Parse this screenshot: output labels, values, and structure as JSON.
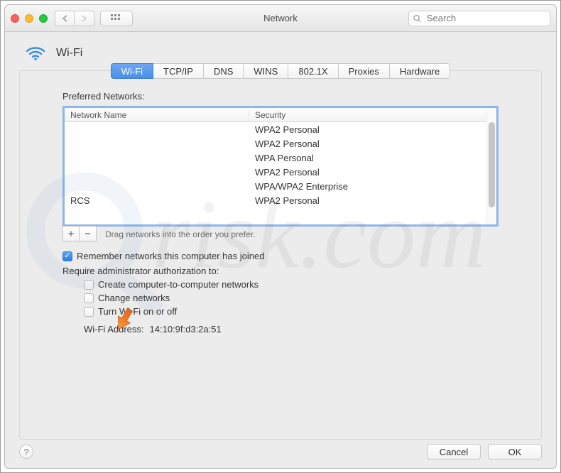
{
  "window": {
    "title": "Network"
  },
  "search": {
    "placeholder": "Search"
  },
  "heading": {
    "label": "Wi-Fi"
  },
  "tabs": {
    "items": [
      "Wi-Fi",
      "TCP/IP",
      "DNS",
      "WINS",
      "802.1X",
      "Proxies",
      "Hardware"
    ],
    "active_index": 0
  },
  "preferred": {
    "label": "Preferred Networks:",
    "columns": {
      "name": "Network Name",
      "security": "Security"
    },
    "rows": [
      {
        "name": "",
        "security": "WPA2 Personal"
      },
      {
        "name": "",
        "security": "WPA2 Personal"
      },
      {
        "name": "",
        "security": "WPA Personal"
      },
      {
        "name": "",
        "security": "WPA2 Personal"
      },
      {
        "name": "",
        "security": "WPA/WPA2 Enterprise"
      },
      {
        "name": "RCS",
        "security": "WPA2 Personal"
      }
    ],
    "hint": "Drag networks into the order you prefer."
  },
  "checkboxes": {
    "remember": {
      "label": "Remember networks this computer has joined",
      "checked": true
    },
    "require_label": "Require administrator authorization to:",
    "create_adhoc": {
      "label": "Create computer-to-computer networks",
      "checked": false
    },
    "change_networks": {
      "label": "Change networks",
      "checked": false
    },
    "turn_wifi": {
      "label": "Turn Wi-Fi on or off",
      "checked": false
    }
  },
  "wifi_address": {
    "label": "Wi-Fi Address:",
    "value": "14:10:9f:d3:2a:51"
  },
  "buttons": {
    "cancel": "Cancel",
    "ok": "OK",
    "add": "+",
    "remove": "−"
  },
  "colors": {
    "accent": "#4a8fe6",
    "selection": "#8bb7ec"
  }
}
